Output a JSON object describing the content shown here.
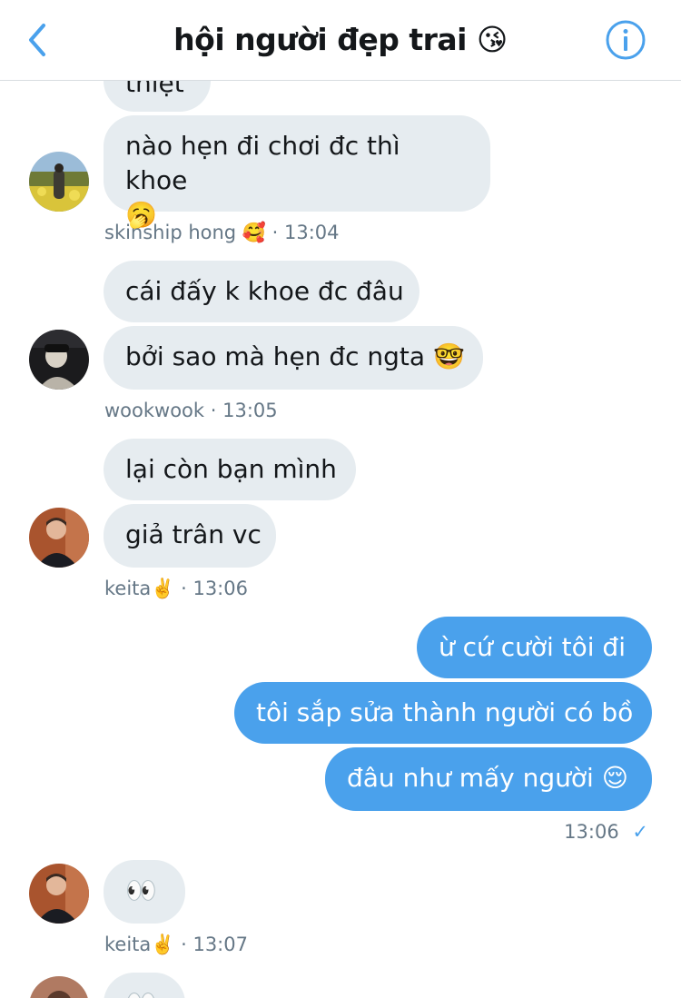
{
  "header": {
    "title": "hội người đẹp trai 😘",
    "back_icon": "chevron-left-icon",
    "info_icon": "info-icon",
    "accent": "#4aa1ec"
  },
  "messages": {
    "m0": {
      "text": "thiệt"
    },
    "m1": {
      "text_line1": "nào hẹn đi chơi đc thì khoe",
      "text_line2": "🥱"
    },
    "meta1": {
      "sender": "skinship hong 🥰",
      "time": "· 13:04"
    },
    "m2": {
      "text": "cái đấy k khoe đc đâu"
    },
    "m3": {
      "text": "bởi sao mà hẹn đc ngta 🤓"
    },
    "meta2": {
      "sender": "wookwook",
      "time": "· 13:05"
    },
    "m4": {
      "text": "lại còn bạn mình"
    },
    "m5": {
      "text": "giả trân vc"
    },
    "meta3": {
      "sender": "keita✌️",
      "time": "· 13:06"
    },
    "m6": {
      "text": "ừ cứ cười tôi đi"
    },
    "m7": {
      "text": "tôi sắp sửa thành người có bồ"
    },
    "m8": {
      "text": "đâu như mấy người 😌"
    },
    "meta4": {
      "time": "13:06",
      "status": "✓"
    },
    "m9": {
      "text": "👀"
    },
    "meta5": {
      "sender": "keita✌️",
      "time": "· 13:07"
    },
    "m10": {
      "text": "👀"
    }
  },
  "colors": {
    "incoming_bubble": "#e6ecf0",
    "outgoing_bubble": "#4aa1ec",
    "meta_text": "#657786"
  }
}
